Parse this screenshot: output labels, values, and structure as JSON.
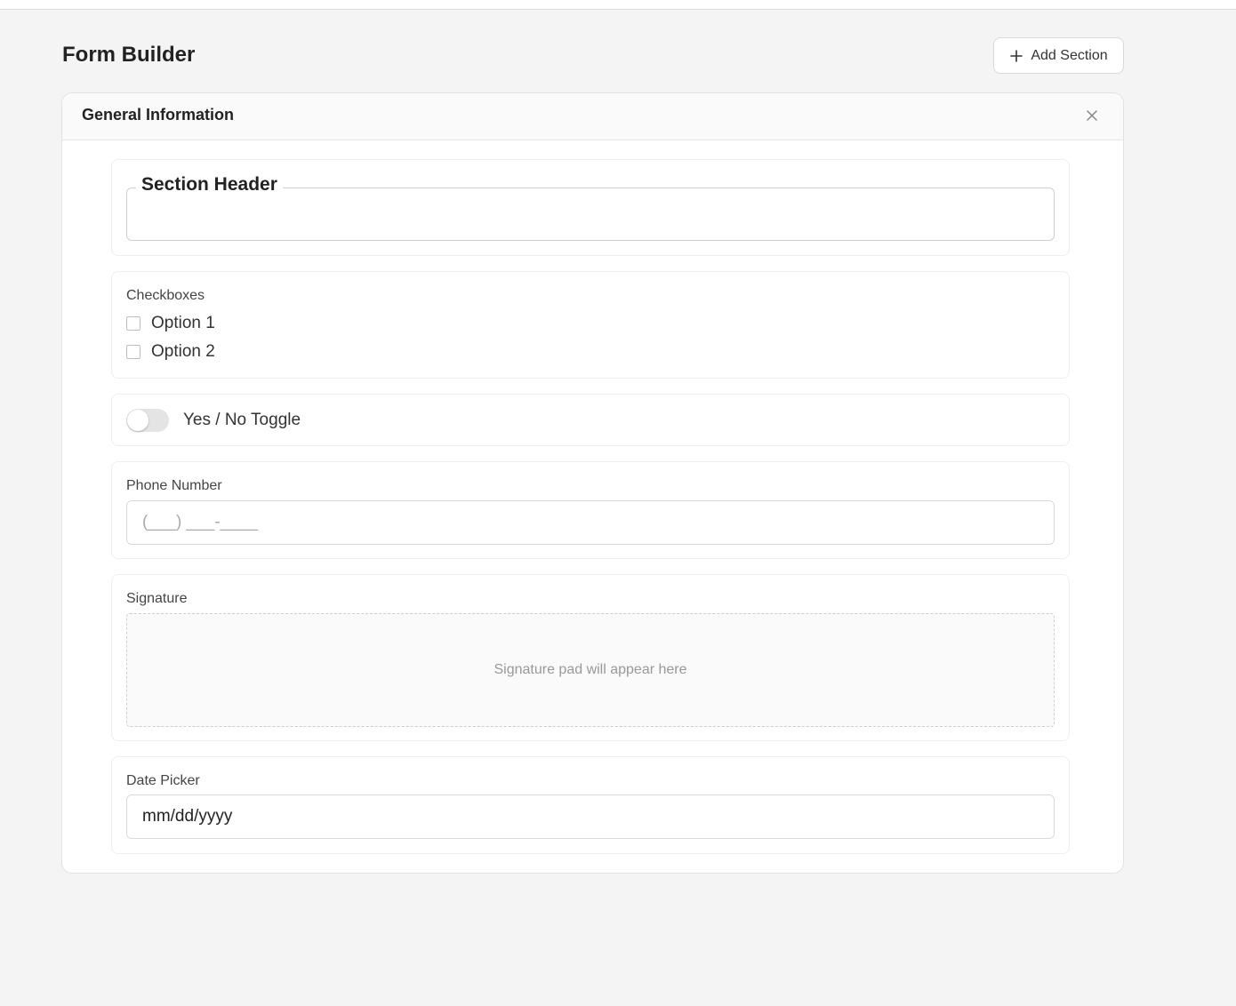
{
  "page": {
    "title": "Form Builder",
    "add_section_label": "Add Section"
  },
  "section": {
    "title": "General Information",
    "fields": {
      "section_header": {
        "legend": "Section Header"
      },
      "checkboxes": {
        "label": "Checkboxes",
        "options": [
          {
            "label": "Option 1",
            "checked": false
          },
          {
            "label": "Option 2",
            "checked": false
          }
        ]
      },
      "toggle": {
        "label": "Yes / No Toggle",
        "on": false
      },
      "phone": {
        "label": "Phone Number",
        "placeholder": "(___) ___-____"
      },
      "signature": {
        "label": "Signature",
        "placeholder": "Signature pad will appear here"
      },
      "date": {
        "label": "Date Picker",
        "value": "mm/dd/yyyy"
      }
    }
  },
  "icons": {
    "add": "plus-icon",
    "close": "close-icon"
  },
  "colors": {
    "background": "#f4f4f4",
    "card": "#ffffff",
    "border": "#e2e2e2",
    "toggle_off": "#e4e4e4",
    "muted_text": "#999999"
  }
}
